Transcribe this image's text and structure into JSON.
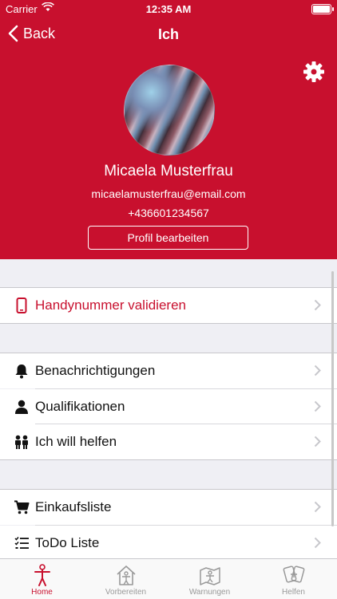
{
  "status": {
    "carrier": "Carrier",
    "time": "12:35 AM"
  },
  "nav": {
    "back_label": "Back",
    "title": "Ich"
  },
  "profile": {
    "name": "Micaela  Musterfrau",
    "email": "micaelamusterfrau@email.com",
    "phone": "+436601234567",
    "edit_label": "Profil bearbeiten"
  },
  "colors": {
    "brand": "#c8102e",
    "background": "#efeff4"
  },
  "section1": [
    {
      "label": "Handynummer validieren",
      "icon": "smartphone-icon"
    }
  ],
  "section2": [
    {
      "label": "Benachrichtigungen",
      "icon": "bell-icon"
    },
    {
      "label": "Qualifikationen",
      "icon": "person-icon"
    },
    {
      "label": "Ich will helfen",
      "icon": "volunteers-icon"
    }
  ],
  "section3": [
    {
      "label": "Einkaufsliste",
      "icon": "cart-icon"
    },
    {
      "label": "ToDo Liste",
      "icon": "checklist-icon"
    }
  ],
  "tabs": [
    {
      "label": "Home",
      "icon": "home-person-icon",
      "active": true
    },
    {
      "label": "Vorbereiten",
      "icon": "house-prepare-icon",
      "active": false
    },
    {
      "label": "Warnungen",
      "icon": "map-warning-icon",
      "active": false
    },
    {
      "label": "Helfen",
      "icon": "helping-hands-icon",
      "active": false
    }
  ]
}
